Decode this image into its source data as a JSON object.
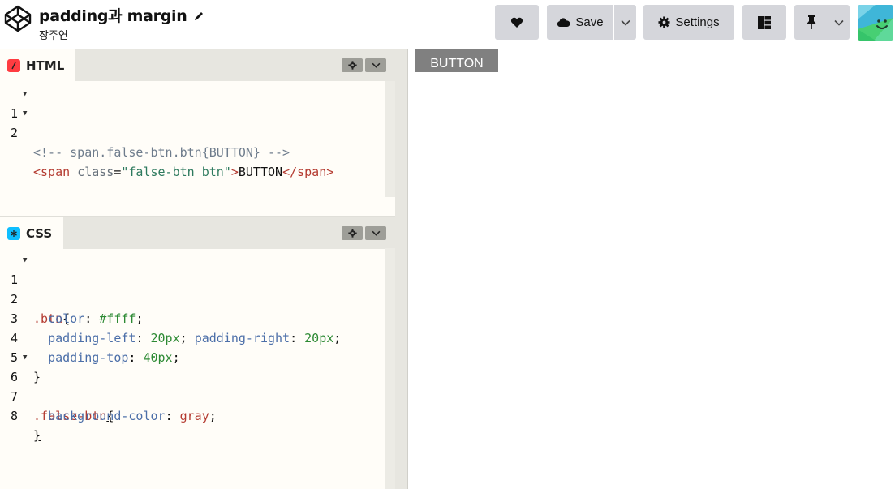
{
  "header": {
    "title": "padding과 margin",
    "author": "장주연",
    "heart_icon": "heart-icon",
    "save_label": "Save",
    "settings_label": "Settings",
    "layout_icon": "layout-icon",
    "pin_icon": "pin-icon"
  },
  "html_pane": {
    "label": "HTML",
    "icon_color": "#ff3c41",
    "lines": [
      {
        "num": "1",
        "comment": "<!-- span.false-btn.btn{BUTTON} -->"
      },
      {
        "num": "2",
        "open": "<span",
        "attr": "class",
        "eq": "=",
        "str": "\"false-btn btn\"",
        "close": ">",
        "text": "BUTTON",
        "endtag": "</span",
        "endclose": ">"
      }
    ]
  },
  "css_pane": {
    "label": "CSS",
    "icon_color": "#0ebeff",
    "lines": [
      {
        "num": "1",
        "sel": ".btn",
        "brace": "{"
      },
      {
        "num": "2",
        "prop": "color",
        "colon": ":",
        "val": "#ffff",
        "semi": ";"
      },
      {
        "num": "3",
        "prop": "padding-left",
        "colon": ":",
        "val": "20px",
        "semi": ";",
        "prop2": "padding-right",
        "colon2": ":",
        "val2": "20px",
        "semi2": ";"
      },
      {
        "num": "4",
        "prop": "padding-top",
        "colon": ":",
        "val": "40px",
        "semi": ";"
      },
      {
        "num": "5",
        "brace": "}"
      },
      {
        "num": "6",
        "sel": ".false-btn",
        "brace": "{"
      },
      {
        "num": "7",
        "prop": "background-color",
        "colon": ":",
        "val": "gray",
        "semi": ";"
      },
      {
        "num": "8",
        "brace": "}"
      }
    ]
  },
  "preview": {
    "button_text": "BUTTON",
    "button_bg": "#808080"
  }
}
